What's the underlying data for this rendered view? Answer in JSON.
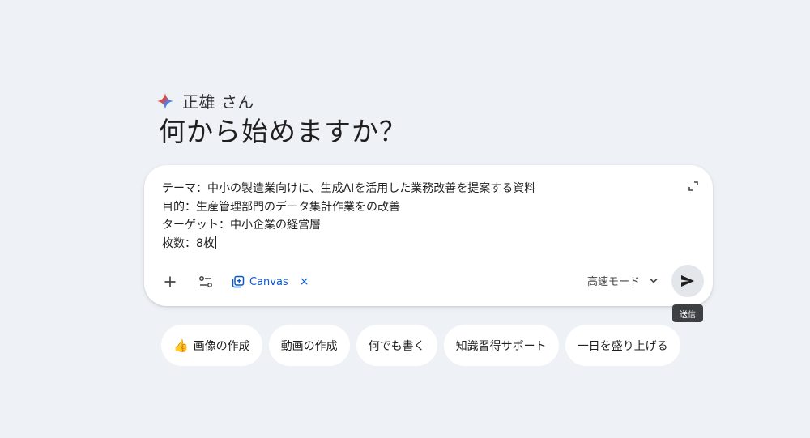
{
  "greeting": {
    "name": "正雄 さん",
    "headline": "何から始めますか？"
  },
  "composer": {
    "prompt_lines": [
      "テーマ：中小の製造業向けに、生成AIを活用した業務改善を提案する資料",
      "目的：生産管理部門のデータ集計作業をの改善",
      "ターゲット：中小企業の経営層",
      "枚数：8枚"
    ],
    "tools": {
      "add_icon": "plus-icon",
      "settings_icon": "tune-icon",
      "canvas_label": "Canvas",
      "canvas_close": "×"
    },
    "mode": {
      "label": "高速モード"
    },
    "send_tooltip": "送信"
  },
  "suggestions": [
    {
      "emoji": "👍",
      "label": "画像の作成"
    },
    {
      "label": "動画の作成"
    },
    {
      "label": "何でも書く"
    },
    {
      "label": "知識習得サポート"
    },
    {
      "label": "一日を盛り上げる"
    }
  ],
  "colors": {
    "background": "#eef1f6",
    "accent_blue": "#0b57d0",
    "send_button_bg": "#e3e6ea",
    "tooltip_bg": "#3c4043"
  }
}
